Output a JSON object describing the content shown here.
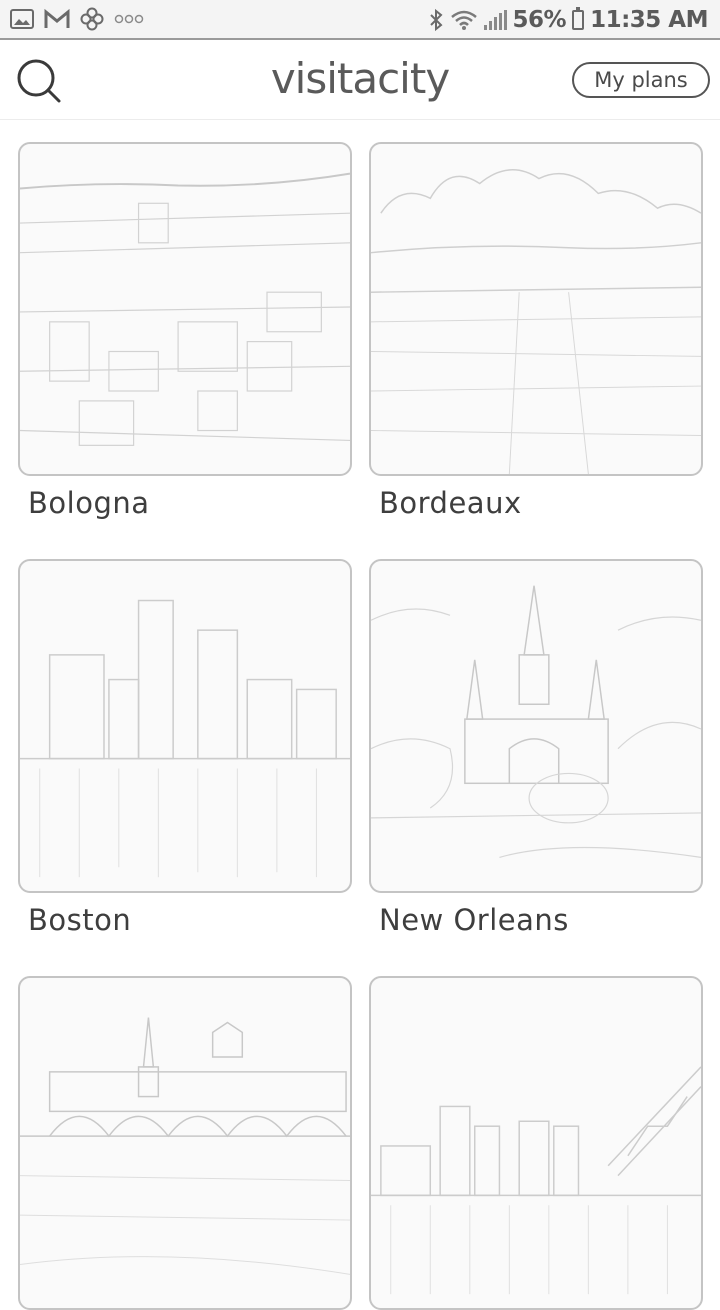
{
  "status_bar": {
    "left_icons": [
      "gallery-icon",
      "gmail-icon",
      "flower-icon",
      "more-dots-icon"
    ],
    "battery_text": "56%",
    "time": "11:35 AM"
  },
  "header": {
    "logo": "visitacity",
    "my_plans_label": "My plans"
  },
  "cities": [
    {
      "name": "Bologna"
    },
    {
      "name": "Bordeaux"
    },
    {
      "name": "Boston"
    },
    {
      "name": "New Orleans"
    },
    {
      "name": ""
    },
    {
      "name": ""
    }
  ]
}
